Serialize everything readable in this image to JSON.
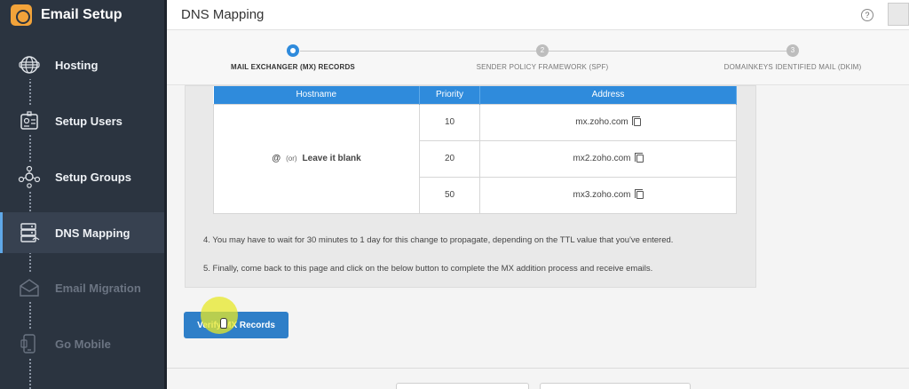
{
  "app": {
    "title": "Email Setup"
  },
  "sidebar": {
    "items": [
      {
        "label": "Hosting",
        "icon": "globe-icon",
        "state": "normal"
      },
      {
        "label": "Setup Users",
        "icon": "user-card-icon",
        "state": "normal"
      },
      {
        "label": "Setup Groups",
        "icon": "group-icon",
        "state": "normal"
      },
      {
        "label": "DNS Mapping",
        "icon": "server-icon",
        "state": "active"
      },
      {
        "label": "Email Migration",
        "icon": "envelope-icon",
        "state": "disabled"
      },
      {
        "label": "Go Mobile",
        "icon": "mobile-icon",
        "state": "disabled"
      }
    ]
  },
  "header": {
    "title": "DNS Mapping",
    "help": "?"
  },
  "stepper": {
    "steps": [
      {
        "number": "1",
        "label": "MAIL EXCHANGER (MX) RECORDS",
        "active": true
      },
      {
        "number": "2",
        "label": "SENDER POLICY FRAMEWORK (SPF)",
        "active": false
      },
      {
        "number": "3",
        "label": "DOMAINKEYS IDENTIFIED MAIL (DKIM)",
        "active": false
      }
    ]
  },
  "mx_table": {
    "headers": [
      "Hostname",
      "Priority",
      "Address"
    ],
    "host": {
      "at": "@",
      "or": "(or)",
      "blank": "Leave it blank"
    },
    "rows": [
      {
        "priority": "10",
        "address": "mx.zoho.com"
      },
      {
        "priority": "20",
        "address": "mx2.zoho.com"
      },
      {
        "priority": "50",
        "address": "mx3.zoho.com"
      }
    ]
  },
  "notes": {
    "step4": "4. You may have to wait for 30 minutes to 1 day for this change to propagate, depending on the TTL value that you've entered.",
    "step5": "5. Finally, come back to this page and click on the below button to complete the MX addition process and receive emails."
  },
  "actions": {
    "verify_label": "Verify MX Records"
  },
  "colors": {
    "accent": "#2f8bdc",
    "sidebar_bg": "#2b3440",
    "button": "#2f7fc8",
    "cursor_highlight": "#e7e828"
  }
}
